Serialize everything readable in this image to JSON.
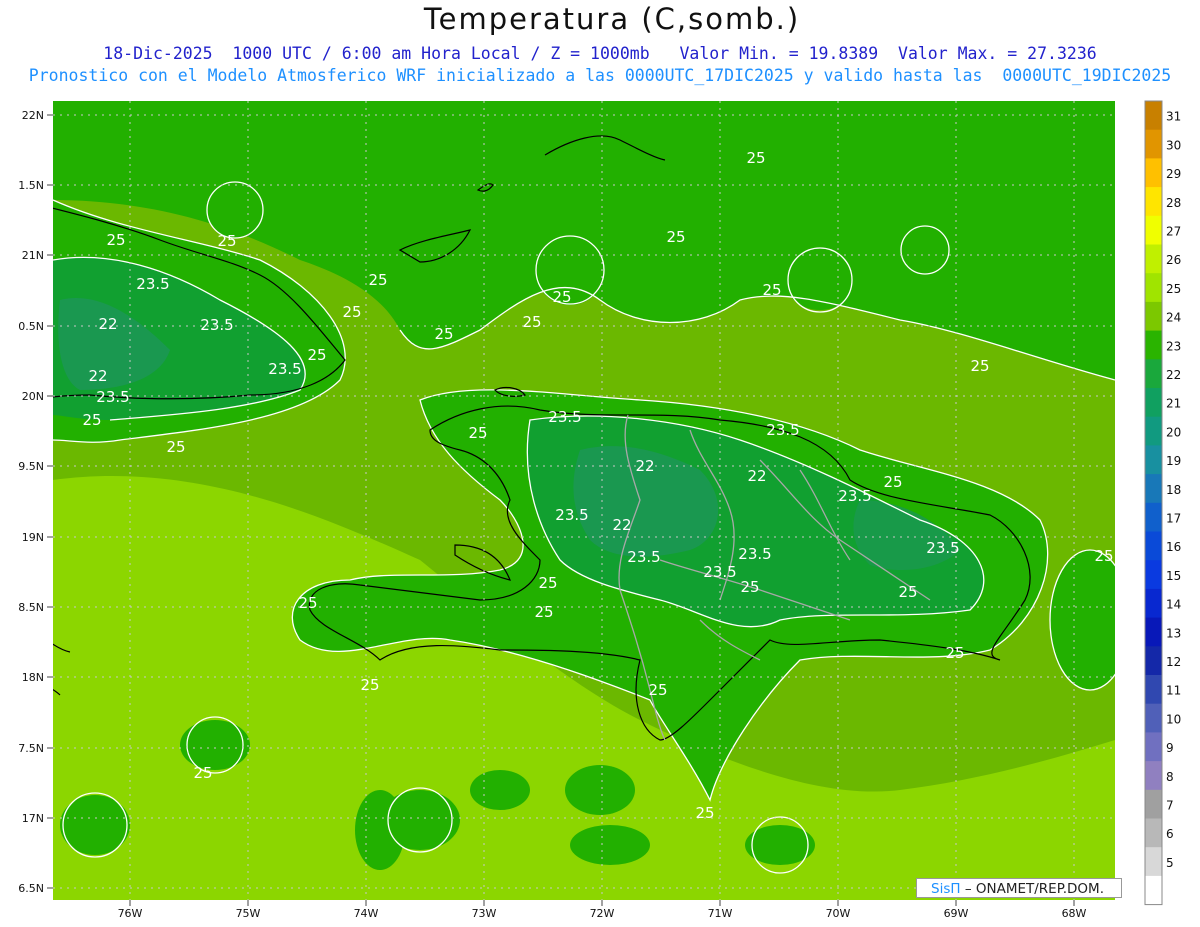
{
  "title": "Temperatura (C,somb.)",
  "subtitle_line1": "18-Dic-2025  1000 UTC / 6:00 am Hora Local / Z = 1000mb   Valor Min. = 19.8389  Valor Max. = 27.3236",
  "subtitle_line2": "Pronostico con el Modelo Atmosferico WRF inicializado a las 0000UTC_17DIC2025 y valido hasta las  0000UTC_19DIC2025",
  "credit": {
    "brand": "SisΠ",
    "org": "– ONAMET/REP.DOM."
  },
  "colors": {
    "title": "#111111",
    "subtitle1": "#2222cc",
    "subtitle2": "#1e90ff",
    "ocean_warm": "#8cd600",
    "band_25": "#6bb800",
    "band_24": "#22b000",
    "band_23": "#11a030",
    "band_22": "#1a9850"
  },
  "axes": {
    "lat_labels": [
      "22N",
      "1.5N",
      "21N",
      "0.5N",
      "20N",
      "9.5N",
      "19N",
      "8.5N",
      "18N",
      "7.5N",
      "17N",
      "6.5N"
    ],
    "lon_labels": [
      "76W",
      "75W",
      "74W",
      "73W",
      "72W",
      "71W",
      "70W",
      "69W",
      "68W"
    ]
  },
  "colorbar": {
    "labels": [
      "31",
      "30",
      "29",
      "28",
      "27",
      "26",
      "25",
      "24",
      "23",
      "22",
      "21",
      "20",
      "19",
      "18",
      "17",
      "16",
      "15",
      "14",
      "13",
      "12",
      "11",
      "10",
      "9",
      "8",
      "7",
      "6",
      "5"
    ],
    "colors": [
      "#c88000",
      "#e19500",
      "#ffc000",
      "#ffe500",
      "#f0ff00",
      "#c0f000",
      "#a0e400",
      "#7cc800",
      "#2ab400",
      "#1aa83c",
      "#10a060",
      "#119a80",
      "#1890a0",
      "#1878b8",
      "#1060cc",
      "#0a4ad8",
      "#0a3ae0",
      "#0828d0",
      "#0818b8",
      "#1428a8",
      "#3048b0",
      "#5060b8",
      "#7070c0",
      "#9080c0",
      "#a0a0a0",
      "#b8b8b8",
      "#d8d8d8",
      "#ffffff"
    ]
  },
  "contour_labels": [
    {
      "text": "25"
    },
    {
      "text": "25"
    },
    {
      "text": "25"
    },
    {
      "text": "23.5"
    },
    {
      "text": "22"
    },
    {
      "text": "23.5"
    },
    {
      "text": "22"
    },
    {
      "text": "23.5"
    },
    {
      "text": "25"
    },
    {
      "text": "25"
    },
    {
      "text": "25"
    },
    {
      "text": "25"
    },
    {
      "text": "25"
    },
    {
      "text": "25"
    },
    {
      "text": "25"
    },
    {
      "text": "23.5"
    },
    {
      "text": "25"
    },
    {
      "text": "23.5"
    },
    {
      "text": "23.5"
    },
    {
      "text": "22"
    },
    {
      "text": "22"
    },
    {
      "text": "23.5"
    },
    {
      "text": "23.5"
    },
    {
      "text": "22"
    },
    {
      "text": "23.5"
    },
    {
      "text": "23.5"
    },
    {
      "text": "23.5"
    },
    {
      "text": "23.5"
    },
    {
      "text": "25"
    },
    {
      "text": "25"
    },
    {
      "text": "25"
    },
    {
      "text": "25"
    },
    {
      "text": "25"
    },
    {
      "text": "25"
    },
    {
      "text": "25"
    },
    {
      "text": "25"
    },
    {
      "text": "25"
    },
    {
      "text": "25"
    },
    {
      "text": "25"
    },
    {
      "text": "25"
    },
    {
      "text": "25"
    },
    {
      "text": "25"
    },
    {
      "text": "25"
    },
    {
      "text": "25"
    }
  ]
}
